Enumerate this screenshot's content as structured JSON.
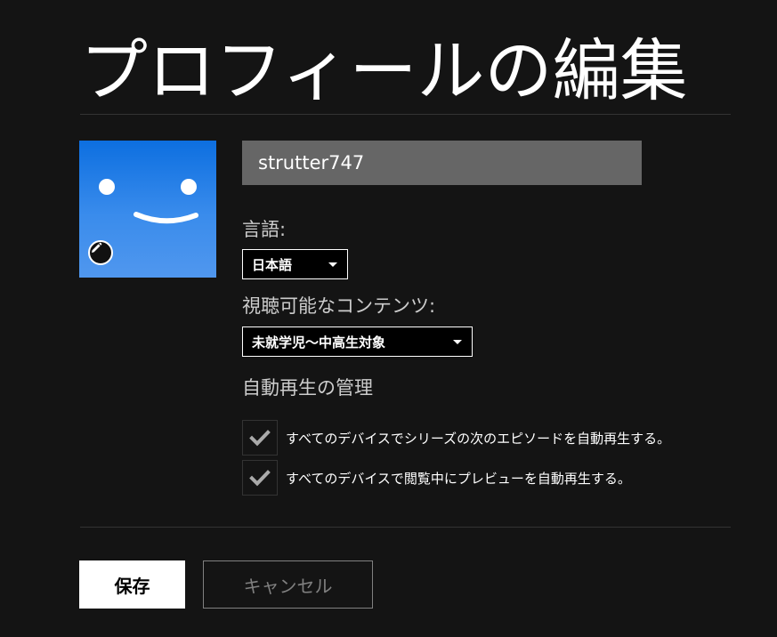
{
  "page": {
    "title": "プロフィールの編集"
  },
  "profile": {
    "name_value": "strutter747",
    "avatar_icon": "smiley-face-icon",
    "avatar_color": "#0d6fe0",
    "edit_icon": "pencil-icon"
  },
  "language": {
    "label": "言語:",
    "selected": "日本語"
  },
  "maturity": {
    "label": "視聴可能なコンテンツ:",
    "selected": "未就学児〜中高生対象"
  },
  "autoplay": {
    "title": "自動再生の管理",
    "options": [
      {
        "label": "すべてのデバイスでシリーズの次のエピソードを自動再生する。",
        "checked": true
      },
      {
        "label": "すべてのデバイスで閲覧中にプレビューを自動再生する。",
        "checked": true
      }
    ]
  },
  "actions": {
    "save_label": "保存",
    "cancel_label": "キャンセル"
  }
}
